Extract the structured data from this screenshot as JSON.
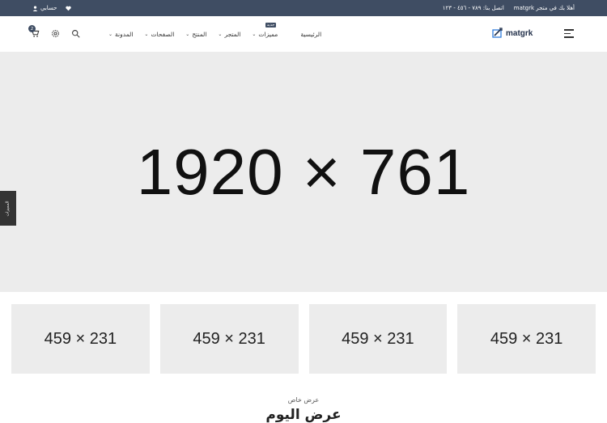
{
  "topbar": {
    "welcome": "أهلا بك في متجر matgrk",
    "contact": "اتصل بنا: ٧٨٩ - ٤٥٦ - ١٢٣",
    "account": "حسابي"
  },
  "header": {
    "logo_text": "matgrk",
    "cart_count": "2"
  },
  "nav": {
    "items": [
      {
        "label": "الرئيسية"
      },
      {
        "label": "مميزات",
        "badge": "جديد"
      },
      {
        "label": "المتجر"
      },
      {
        "label": "المنتج"
      },
      {
        "label": "الصفحات"
      },
      {
        "label": "المدونة"
      }
    ]
  },
  "hero": {
    "placeholder": "1920 × 761"
  },
  "side_tab": {
    "label": "المميزات"
  },
  "banners": [
    {
      "placeholder": "459 × 231"
    },
    {
      "placeholder": "459 × 231"
    },
    {
      "placeholder": "459 × 231"
    },
    {
      "placeholder": "459 × 231"
    }
  ],
  "offer": {
    "subtitle": "عرض خاص",
    "title": "عرض اليوم"
  },
  "colors": {
    "topbar_bg": "#3f4d63",
    "placeholder_bg": "#ececec"
  }
}
